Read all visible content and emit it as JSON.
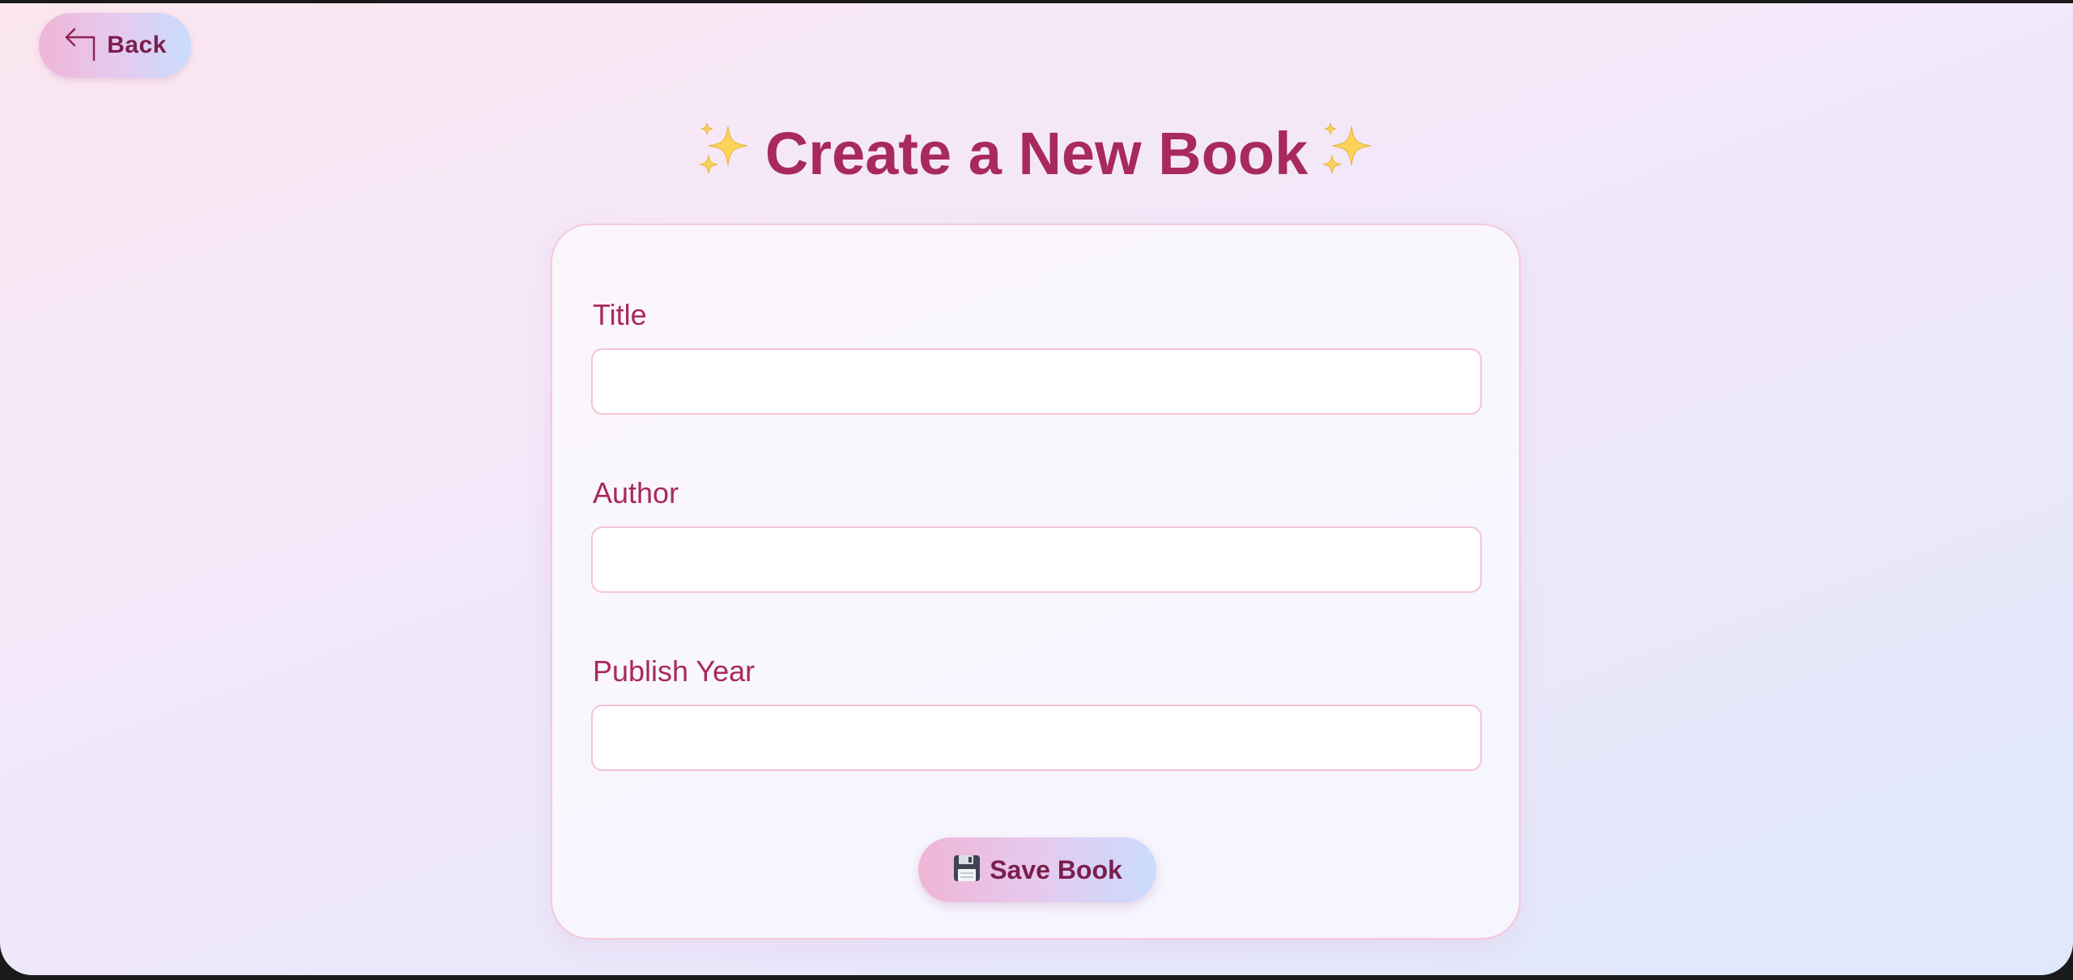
{
  "header": {
    "back_label": "Back",
    "title": "Create a New Book",
    "title_icon": "sparkles-icon"
  },
  "form": {
    "fields": [
      {
        "label": "Title",
        "value": "",
        "placeholder": ""
      },
      {
        "label": "Author",
        "value": "",
        "placeholder": ""
      },
      {
        "label": "Publish Year",
        "value": "",
        "placeholder": ""
      }
    ],
    "submit_label": "Save Book",
    "submit_icon": "floppy-disk-icon"
  },
  "colors": {
    "accent": "#a82a5c",
    "button_text": "#7a1e4c",
    "input_border": "#f3c4d9",
    "button_gradient_start": "#efb5d6",
    "button_gradient_end": "#c9dcfc"
  }
}
